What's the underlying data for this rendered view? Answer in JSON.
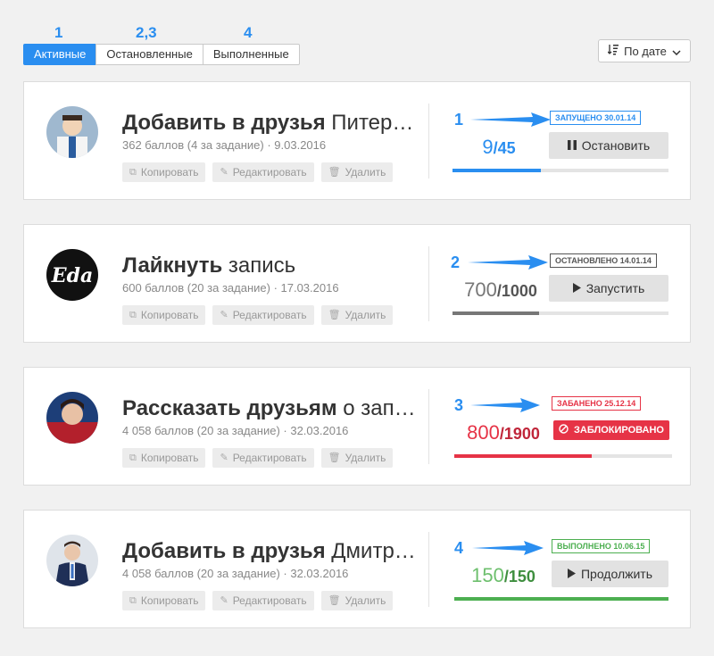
{
  "tabs": {
    "numbers": [
      "1",
      "2,3",
      "4"
    ],
    "items": [
      "Активные",
      "Остановленные",
      "Выполненные"
    ]
  },
  "sort": {
    "label": "По дате",
    "icon": "sort-icon"
  },
  "actions": {
    "copy": "Копировать",
    "edit": "Редактировать",
    "delete": "Удалить"
  },
  "cards": [
    {
      "num": "1",
      "title_bold": "Добавить в друзья",
      "title_rest": "Питер …",
      "sub": "362 баллов (4 за задание) · 9.03.2016",
      "badge": "ЗАПУЩЕНО 30.01.14",
      "current": "9",
      "total": "/45",
      "progress": 0.41,
      "button": "Остановить",
      "button_icon": "pause-icon",
      "color": "#2a8ef0"
    },
    {
      "num": "2",
      "title_bold": "Лайкнуть",
      "title_rest": "запись",
      "sub": "600 баллов (20 за задание) · 17.03.2016",
      "badge": "ОСТАНОВЛЕНО 14.01.14",
      "current": "700",
      "total": "/1000",
      "progress": 0.4,
      "button": "Запустить",
      "button_icon": "play-icon",
      "color": "#777777"
    },
    {
      "num": "3",
      "title_bold": "Рассказать друзьям",
      "title_rest": "о зап…",
      "sub": "4 058 баллов (20 за задание) · 32.03.2016",
      "badge": "ЗАБАНЕНО 25.12.14",
      "current": "800",
      "total": "/1900",
      "progress": 0.63,
      "button": "ЗАБЛОКИРОВАНО",
      "button_icon": "ban-icon",
      "color": "#e63346"
    },
    {
      "num": "4",
      "title_bold": "Добавить в друзья",
      "title_rest": "Дмитр…",
      "sub": "4 058 баллов (20 за задание) · 32.03.2016",
      "badge": "ВЫПОЛНЕНО 10.06.15",
      "current": "150",
      "total": "/150",
      "progress": 1.0,
      "button": "Продолжить",
      "button_icon": "play-icon",
      "color": "#4caf50"
    }
  ]
}
